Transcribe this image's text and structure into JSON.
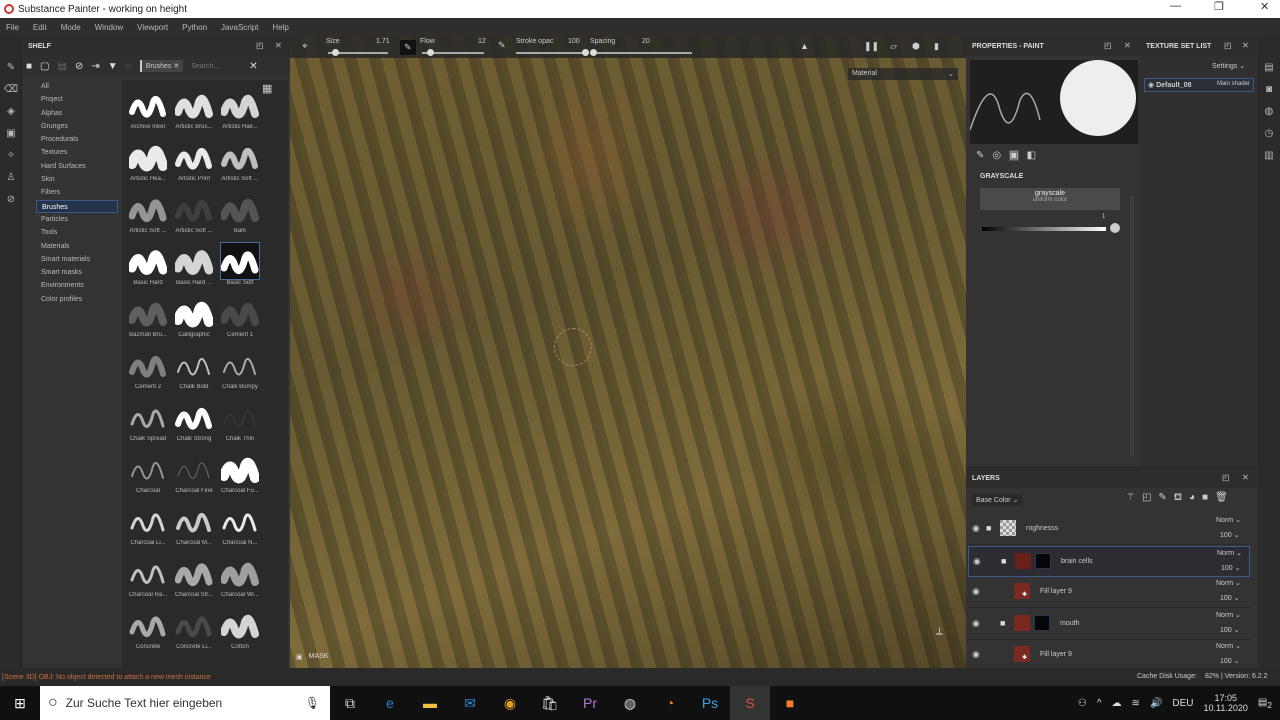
{
  "window": {
    "title": "Substance Painter - working on height"
  },
  "menu": [
    "File",
    "Edit",
    "Mode",
    "Window",
    "Viewport",
    "Python",
    "JavaScript",
    "Help"
  ],
  "shelf": {
    "title": "SHELF",
    "filter_chip": "Brushes",
    "search_placeholder": "Search...",
    "categories": [
      "All",
      "Project",
      "Alphas",
      "Grunges",
      "Procedurals",
      "Textures",
      "Hard Surfaces",
      "Skin",
      "Filters",
      "Brushes",
      "Particles",
      "Tools",
      "Materials",
      "Smart materials",
      "Smart masks",
      "Environments",
      "Color profiles"
    ],
    "selected_category": "Brushes",
    "brushes": [
      "Archive Inker",
      "Artistic Brus...",
      "Artistic Hair...",
      "Artistic Hea...",
      "Artistic Print",
      "Artistic Soft ...",
      "Artistic Soft ...",
      "Artistic Soft ...",
      "Bark",
      "Basic Hard",
      "Basic Hard ...",
      "Basic Soft",
      "Bazmati Bru...",
      "Calligraphic",
      "Cement 1",
      "Cement 2",
      "Chalk Bold",
      "Chalk Bumpy",
      "Chalk Spread",
      "Chalk Strong",
      "Chalk Thin",
      "Charcoal",
      "Charcoal Fine",
      "Charcoal Fu...",
      "Charcoal Li...",
      "Charcoal M...",
      "Charcoal N...",
      "Charcoal Ra...",
      "Charcoal Str...",
      "Charcoal Wi...",
      "Concrete",
      "Concrete Li...",
      "Cotton"
    ],
    "selected_brush": "Basic Soft"
  },
  "toolbar": {
    "size_label": "Size",
    "size_value": "1.71",
    "flow_label": "Flow",
    "flow_value": "12",
    "stroke_label": "Stroke opac",
    "stroke_value": "100",
    "spacing_label": "Spacing",
    "spacing_value": "20"
  },
  "viewport": {
    "material_select": "Material",
    "mask_label": "MASK"
  },
  "properties": {
    "title": "PROPERTIES - PAINT",
    "section": "GRAYSCALE",
    "channel_name": "grayscale",
    "channel_sub": "uniform color",
    "slider_value": "1",
    "slider_fraction": 1.0
  },
  "texture_set": {
    "title": "TEXTURE SET LIST",
    "settings": "Settings",
    "item": "Default_08",
    "shader": "Main shader"
  },
  "layers": {
    "title": "LAYERS",
    "channel": "Base Color",
    "items": [
      {
        "name": "roghnesss",
        "blend": "Norm",
        "opacity": "100",
        "type": "folder",
        "color": "#cccccc"
      },
      {
        "name": "brain cells",
        "blend": "Norm",
        "opacity": "100",
        "type": "folder",
        "color": "#6a1f18",
        "selected": true
      },
      {
        "name": "Fill layer 9",
        "blend": "Norm",
        "opacity": "100",
        "type": "fill",
        "color": "#7a2a20"
      },
      {
        "name": "mouth",
        "blend": "Norm",
        "opacity": "100",
        "type": "folder",
        "color": "#7a2a20"
      },
      {
        "name": "Fill layer 9",
        "blend": "Norm",
        "opacity": "100",
        "type": "fill",
        "color": "#7a2a20"
      }
    ]
  },
  "status": {
    "message": "[Scene 3D] OBJ: No object detected to attach a new mesh instance",
    "cache": "Cache Disk Usage:",
    "cache_value": "82% | Version: 6.2.2"
  },
  "taskbar": {
    "search_placeholder": "Zur Suche Text hier eingeben",
    "lang": "DEU",
    "time": "17:05",
    "date": "10.11.2020",
    "notifications": "2"
  },
  "colors": {
    "accent": "#3d5a86",
    "status_text": "#c8703a"
  }
}
